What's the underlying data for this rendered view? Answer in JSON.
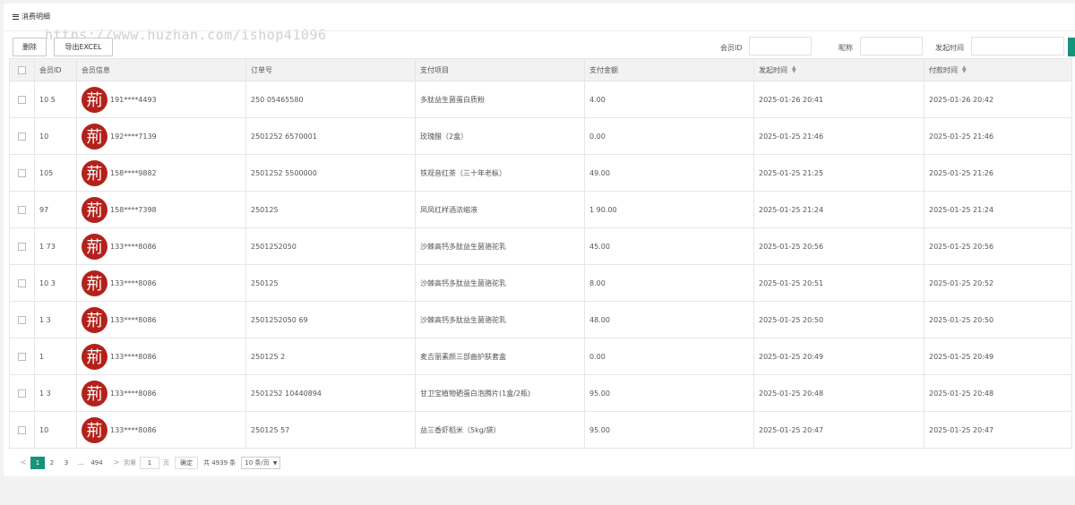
{
  "page": {
    "title": "消费明细",
    "watermark": "https://www.huzhan.com/ishop41096"
  },
  "toolbar": {
    "delete_label": "删除",
    "export_label": "导出EXCEL"
  },
  "filters": {
    "member_id_label": "会员ID",
    "nickname_label": "昵称",
    "start_time_label": "发起时间"
  },
  "table": {
    "columns": [
      "会员ID",
      "会员信息",
      "订单号",
      "支付项目",
      "支付金额",
      "发起时间",
      "付款时间"
    ],
    "rows": [
      {
        "member_id": "10  5",
        "avatar_glyph": "荊",
        "phone": "191****4493",
        "order_no": "250             05465580",
        "item": "多肽益生菌蛋白质粉",
        "amount": " 4.00",
        "created": "2025-01-26 20:41",
        "paid": "2025-01-26 20:42"
      },
      {
        "member_id": "10   ",
        "avatar_glyph": "荊",
        "phone": "192****7139",
        "order_no": "2501252          6570001",
        "item": "玫瑰醋（2盒）",
        "amount": " 0.00",
        "created": "2025-01-25 21:46",
        "paid": "2025-01-25 21:46"
      },
      {
        "member_id": "105  ",
        "avatar_glyph": "荊",
        "phone": "158****9882",
        "order_no": "2501252          5500000",
        "item": "铁观音红茶（三十年老枞）",
        "amount": "  49.00",
        "created": "2025-01-25 21:25",
        "paid": "2025-01-25 21:26"
      },
      {
        "member_id": "97   ",
        "avatar_glyph": "荊",
        "phone": "158****7398",
        "order_no": "250125             ",
        "item": "凤凤红样酒浓缩液",
        "amount": "1 90.00",
        "created": "2025-01-25 21:24",
        "paid": "2025-01-25 21:24"
      },
      {
        "member_id": "1  73",
        "avatar_glyph": "荊",
        "phone": "133****8086",
        "order_no": "2501252050        ",
        "item": "沙棘高钙多肽益生菌骆驼乳",
        "amount": " 45.00",
        "created": "2025-01-25 20:56",
        "paid": "2025-01-25 20:56"
      },
      {
        "member_id": "10  3",
        "avatar_glyph": "荊",
        "phone": "133****8086",
        "order_no": "250125           ",
        "item": "沙棘高钙多肽益生菌骆驼乳",
        "amount": " 8.00",
        "created": "2025-01-25 20:51",
        "paid": "2025-01-25 20:52"
      },
      {
        "member_id": "1   3",
        "avatar_glyph": "荊",
        "phone": "133****8086",
        "order_no": "2501252050      69",
        "item": "沙棘高钙多肽益生菌骆驼乳",
        "amount": " 48.00",
        "created": "2025-01-25 20:50",
        "paid": "2025-01-25 20:50"
      },
      {
        "member_id": "1    ",
        "avatar_glyph": "荊",
        "phone": "133****8086",
        "order_no": "250125           2",
        "item": "麦吉丽素颜三部曲护肤套盒",
        "amount": "  0.00",
        "created": "2025-01-25 20:49",
        "paid": "2025-01-25 20:49"
      },
      {
        "member_id": "1   3",
        "avatar_glyph": "荊",
        "phone": "133****8086",
        "order_no": "2501252   10440894",
        "item": "甘卫宝植物硒蛋白泡腾片(1盒/2瓶)",
        "amount": " 95.00",
        "created": "2025-01-25 20:48",
        "paid": "2025-01-25 20:48"
      },
      {
        "member_id": "10   ",
        "avatar_glyph": "荊",
        "phone": "133****8086",
        "order_no": "250125          57",
        "item": "益三香虾稻米（5kg/袋）",
        "amount": " 95.00",
        "created": "2025-01-25 20:47",
        "paid": "2025-01-25 20:47"
      }
    ]
  },
  "pagination": {
    "prev": "<",
    "pages": [
      "1",
      "2",
      "3"
    ],
    "ellipsis": "…",
    "last_page": "494",
    "next": ">",
    "goto_label": "到第",
    "goto_value": "1",
    "page_unit": "页",
    "confirm_label": "确定",
    "total_text": "共 4939 条",
    "page_size": "10 条/页",
    "current_page": "1"
  },
  "colors": {
    "accent": "#14957a",
    "avatar_bg": "#b4211a"
  }
}
